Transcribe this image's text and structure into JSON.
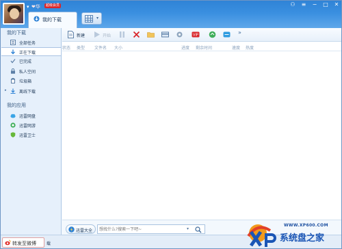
{
  "titlebar": {
    "user_name": "❤华",
    "vip_badge": "超级会员",
    "active_tab": "我的下载",
    "grid_tab_caret": "▾",
    "user_chevron": "▾",
    "controls": {
      "skin": "⚇",
      "menu": "≡",
      "minimize": "−",
      "maximize": "□",
      "close": "✕"
    }
  },
  "sidebar": {
    "my_downloads_header": "我的下载",
    "my_apps_header": "我的应用",
    "download_items": [
      {
        "label": "全部任务",
        "icon": "list-icon"
      },
      {
        "label": "正在下载",
        "icon": "download-arrow-icon"
      },
      {
        "label": "已完成",
        "icon": "checkmark-icon"
      },
      {
        "label": "私人空间",
        "icon": "lock-icon"
      },
      {
        "label": "垃圾箱",
        "icon": "trash-icon"
      },
      {
        "label": "离线下载",
        "icon": "offline-download-icon"
      }
    ],
    "app_items": [
      {
        "label": "迅雷网盘",
        "icon": "cloud-disk-icon"
      },
      {
        "label": "迅雷网游",
        "icon": "game-icon"
      },
      {
        "label": "迅雷卫士",
        "icon": "shield-icon"
      }
    ],
    "active_index": 1
  },
  "toolbar": {
    "new_label": "新建",
    "start_label": "开始",
    "more": "»"
  },
  "columns": [
    "状态",
    "类型",
    "文件名",
    "大小",
    "进度",
    "剩余时间",
    "速度",
    "热度"
  ],
  "bottom": {
    "brand_label": "迅雷大全",
    "search_placeholder": "想找什么?搜索一下吧~",
    "search_caret": "▾"
  },
  "status": {
    "weibo_label": "转发至微博",
    "text": "载"
  },
  "watermark": {
    "url": "WWW.XP600.COM",
    "title": "系统盘之家"
  },
  "colors": {
    "titlebar": "#3a8fe0",
    "sidebar": "#e6f0fb",
    "accent": "#2f83d6",
    "delete_red": "#d9262a"
  }
}
